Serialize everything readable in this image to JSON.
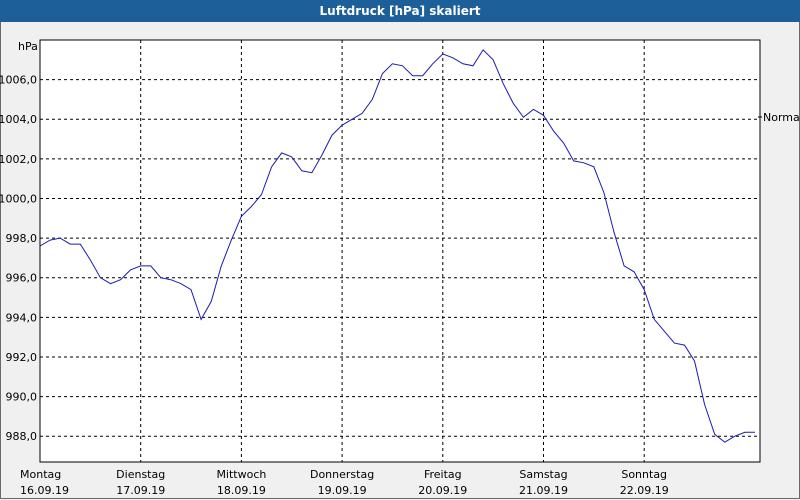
{
  "window": {
    "title": "Luftdruck [hPa] skaliert"
  },
  "chart_data": {
    "type": "line",
    "title": "Luftdruck [hPa] skaliert",
    "ylabel": "hPa",
    "ylim": [
      986.7,
      1008.0
    ],
    "y_ticks": [
      "988,0",
      "990,0",
      "992,0",
      "994,0",
      "996,0",
      "998,0",
      "1000,0",
      "1002,0",
      "1004,0",
      "1006,0"
    ],
    "y_tick_values": [
      988,
      990,
      992,
      994,
      996,
      998,
      1000,
      1002,
      1004,
      1006
    ],
    "x_ticks": [
      {
        "day": "Montag",
        "date": "16.09.19"
      },
      {
        "day": "Dienstag",
        "date": "17.09.19"
      },
      {
        "day": "Mittwoch",
        "date": "18.09.19"
      },
      {
        "day": "Donnerstag",
        "date": "19.09.19"
      },
      {
        "day": "Freitag",
        "date": "20.09.19"
      },
      {
        "day": "Samstag",
        "date": "21.09.19"
      },
      {
        "day": "Sonntag",
        "date": "22.09.19"
      }
    ],
    "xlim": [
      0,
      7.15
    ],
    "grid": true,
    "legend_label": "Normal",
    "line_color": "#1a1ab4",
    "series": [
      {
        "x": [
          0,
          0.1,
          0.2,
          0.3,
          0.4,
          0.5,
          0.6,
          0.7,
          0.8,
          0.9,
          1.0,
          1.1,
          1.2,
          1.3,
          1.4,
          1.5,
          1.6,
          1.7,
          1.8,
          1.9,
          2.0,
          2.1,
          2.2,
          2.3,
          2.4,
          2.5,
          2.6,
          2.7,
          2.8,
          2.9,
          3.0,
          3.1,
          3.2,
          3.3,
          3.4,
          3.5,
          3.6,
          3.7,
          3.8,
          3.9,
          4.0,
          4.1,
          4.2,
          4.3,
          4.4,
          4.5,
          4.6,
          4.7,
          4.8,
          4.9,
          5.0,
          5.1,
          5.2,
          5.3,
          5.4,
          5.5,
          5.6,
          5.7,
          5.8,
          5.9,
          6.0,
          6.1,
          6.2,
          6.3,
          6.4,
          6.5,
          6.6,
          6.7,
          6.8,
          6.9,
          7.0,
          7.1
        ],
        "values": [
          997.6,
          997.9,
          998.0,
          997.7,
          997.7,
          996.9,
          996.0,
          995.7,
          995.9,
          996.4,
          996.6,
          996.6,
          996.0,
          995.9,
          995.7,
          995.4,
          993.9,
          994.8,
          996.6,
          997.9,
          999.1,
          999.6,
          1000.2,
          1001.6,
          1002.3,
          1002.1,
          1001.4,
          1001.3,
          1002.2,
          1003.2,
          1003.7,
          1004.0,
          1004.3,
          1005.0,
          1006.3,
          1006.8,
          1006.7,
          1006.2,
          1006.2,
          1006.8,
          1007.3,
          1007.1,
          1006.8,
          1006.7,
          1007.5,
          1007.0,
          1005.8,
          1004.8,
          1004.1,
          1004.5,
          1004.2,
          1003.4,
          1002.8,
          1001.9,
          1001.8,
          1001.6,
          1000.3,
          998.3,
          996.6,
          996.3,
          995.4,
          993.9,
          993.3,
          992.7,
          992.6,
          991.8,
          989.6,
          988.1,
          987.7,
          988.0,
          988.2,
          988.2
        ]
      }
    ]
  }
}
